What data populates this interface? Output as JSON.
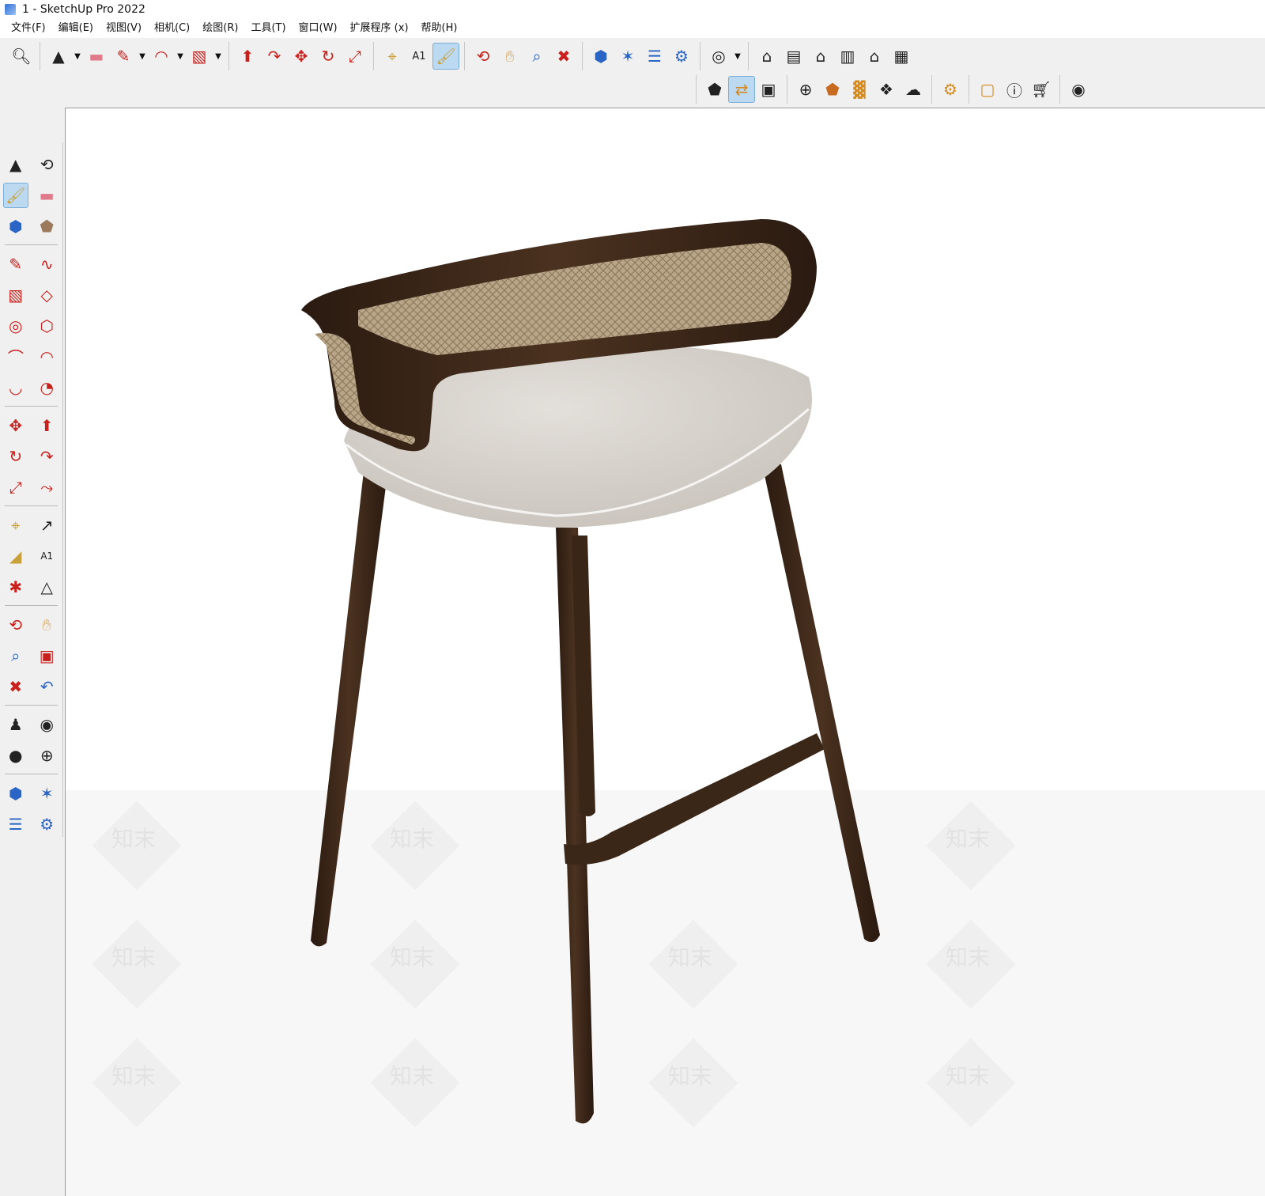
{
  "window": {
    "title": "1 - SketchUp Pro 2022"
  },
  "menu": [
    "文件(F)",
    "编辑(E)",
    "视图(V)",
    "相机(C)",
    "绘图(R)",
    "工具(T)",
    "窗口(W)",
    "扩展程序 (x)",
    "帮助(H)"
  ],
  "toolbar_top": {
    "groups": [
      [
        "search-icon"
      ],
      [
        "select-icon",
        "eraser-icon",
        "pencil-icon",
        "arc-icon",
        "rectangle-icon"
      ],
      [
        "push-pull-icon",
        "follow-me-icon",
        "move-icon",
        "rotate-icon",
        "scale-icon"
      ],
      [
        "tape-measure-icon",
        "text-icon",
        "paint-bucket-icon"
      ],
      [
        "orbit-icon",
        "pan-icon",
        "zoom-icon",
        "zoom-extents-icon"
      ],
      [
        "3d-warehouse-icon",
        "extension-warehouse-icon",
        "layout-icon",
        "extension-manager-icon"
      ],
      [
        "account-icon"
      ],
      [
        "iso-view-icon",
        "top-view-icon",
        "front-view-icon",
        "right-view-icon",
        "back-view-icon",
        "left-view-icon"
      ]
    ]
  },
  "toolbar_second": {
    "groups": [
      [
        "add-location-icon",
        "sync-icon",
        "styles-icon"
      ],
      [
        "add-icon",
        "sandbox-icon",
        "section-icon",
        "checkerboard-icon",
        "cloud-icon"
      ],
      [
        "settings-icon"
      ],
      [
        "chat-icon",
        "info-icon",
        "cart-icon"
      ],
      [
        "user-icon"
      ]
    ]
  },
  "left_toolbar": {
    "rows": [
      [
        "select-icon",
        "orbit-icon"
      ],
      [
        "paint-bucket-icon",
        "eraser-icon"
      ],
      [
        "component-icon",
        "tag-icon"
      ],
      "sep",
      [
        "pencil-icon",
        "freehand-icon"
      ],
      [
        "rectangle-icon",
        "rotated-rectangle-icon"
      ],
      [
        "circle-icon",
        "polygon-icon"
      ],
      [
        "arc-icon",
        "two-point-arc-icon"
      ],
      [
        "three-point-arc-icon",
        "pie-icon"
      ],
      "sep",
      [
        "move-icon",
        "push-pull-icon"
      ],
      [
        "rotate-icon",
        "follow-me-icon"
      ],
      [
        "scale-icon",
        "offset-icon"
      ],
      "sep",
      [
        "tape-measure-icon",
        "dimension-icon"
      ],
      [
        "protractor-icon",
        "text-icon"
      ],
      [
        "axes-icon",
        "3d-text-icon"
      ],
      "sep",
      [
        "orbit-icon",
        "pan-icon"
      ],
      [
        "zoom-icon",
        "zoom-window-icon"
      ],
      [
        "zoom-extents-icon",
        "previous-view-icon"
      ],
      "sep",
      [
        "position-camera-icon",
        "look-around-icon"
      ],
      [
        "walk-icon",
        "section-plane-icon"
      ],
      "sep",
      [
        "3d-warehouse-icon",
        "extension-warehouse-icon"
      ],
      [
        "layout-icon",
        "extension-manager-icon"
      ]
    ]
  },
  "viewport": {
    "watermark": "知末",
    "background": "#ffffff",
    "ground": "#f7f7f7"
  },
  "colors": {
    "wood": "#3b2718",
    "wood_light": "#5a3d26",
    "rattan": "#b7a487",
    "seat": "#d9d4ce",
    "active_tool": "#bcd9f2"
  }
}
